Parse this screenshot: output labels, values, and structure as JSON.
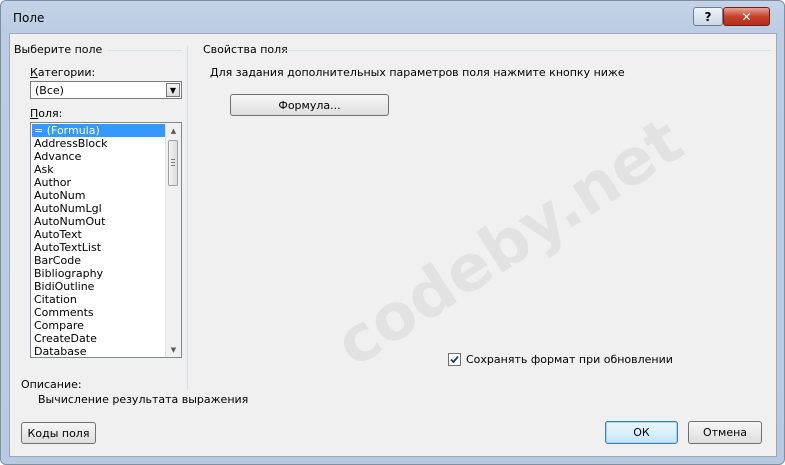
{
  "window": {
    "title": "Поле",
    "help_label": "?",
    "close_label": "✕"
  },
  "left": {
    "group_title": "Выберите поле",
    "categories_label": "Категории:",
    "categories_value": "(Все)",
    "fields_label": "Поля:",
    "fields": [
      "= (Formula)",
      "AddressBlock",
      "Advance",
      "Ask",
      "Author",
      "AutoNum",
      "AutoNumLgl",
      "AutoNumOut",
      "AutoText",
      "AutoTextList",
      "BarCode",
      "Bibliography",
      "BidiOutline",
      "Citation",
      "Comments",
      "Compare",
      "CreateDate",
      "Database"
    ],
    "selected_index": 0,
    "description_label": "Описание:",
    "description_text": "Вычисление результата выражения"
  },
  "right": {
    "group_title": "Свойства поля",
    "hint": "Для задания дополнительных параметров поля нажмите кнопку ниже",
    "formula_button": "Формула...",
    "preserve_label": "Сохранять формат при обновлении",
    "preserve_checked": true
  },
  "buttons": {
    "field_codes": "Коды поля",
    "ok": "ОК",
    "cancel": "Отмена"
  },
  "watermark": "codeby.net",
  "icons": {
    "dropdown": "chevron-down-icon",
    "scroll_up": "scroll-up-icon",
    "scroll_down": "scroll-down-icon",
    "check": "checkmark-icon"
  }
}
